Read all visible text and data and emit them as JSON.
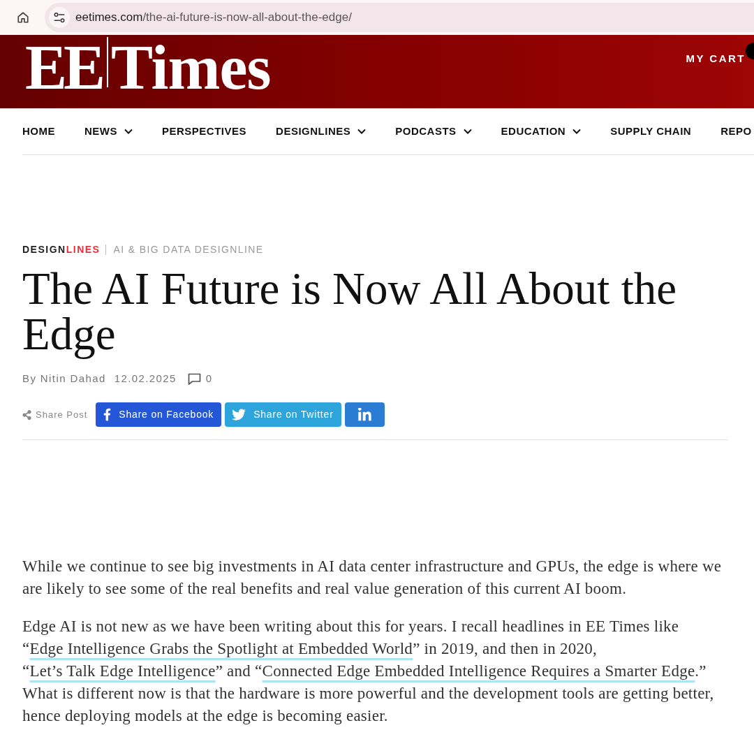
{
  "browser": {
    "url_host": "eetimes.com",
    "url_path": "/the-ai-future-is-now-all-about-the-edge/"
  },
  "header": {
    "logo": {
      "left": "EE",
      "right": "Times"
    },
    "cart": "MY CART"
  },
  "nav": {
    "items": [
      {
        "label": "HOME",
        "has_menu": false
      },
      {
        "label": "NEWS",
        "has_menu": true
      },
      {
        "label": "PERSPECTIVES",
        "has_menu": false
      },
      {
        "label": "DESIGNLINES",
        "has_menu": true
      },
      {
        "label": "PODCASTS",
        "has_menu": true
      },
      {
        "label": "EDUCATION",
        "has_menu": true
      },
      {
        "label": "SUPPLY CHAIN",
        "has_menu": false
      },
      {
        "label": "REPO",
        "has_menu": false
      }
    ]
  },
  "article": {
    "section": {
      "dark": "DESIGN",
      "accent": "LINES"
    },
    "category": "AI & BIG DATA DESIGNLINE",
    "title": "The AI Future is Now All About the Edge",
    "byline": "By Nitin Dahad",
    "date": "12.02.2025",
    "comment_count": "0",
    "share_label": "Share Post",
    "share_buttons": [
      {
        "kind": "facebook",
        "label": "Share on Facebook"
      },
      {
        "kind": "twitter",
        "label": "Share on Twitter"
      },
      {
        "kind": "linkedin"
      }
    ],
    "paragraphs": [
      [
        {
          "kind": "text",
          "text": "While we continue to see big investments in AI data center infrastructure and GPUs, the edge is where we are likely to see some of the real benefits and real value generation of this current AI boom."
        }
      ],
      [
        {
          "kind": "text",
          "text": "Edge AI is not new as we have been writing about this for years. I recall headlines in EE Times like “"
        },
        {
          "kind": "link",
          "text": "Edge Intelligence Grabs the Spotlight at Embedded World"
        },
        {
          "kind": "text",
          "text": "” in 2019, and then in 2020, “"
        },
        {
          "kind": "link",
          "text": "Let’s Talk Edge Intelligence"
        },
        {
          "kind": "text",
          "text": "” and “"
        },
        {
          "kind": "link",
          "text": "Connected Edge Embedded Intelligence Requires a Smarter Edge"
        },
        {
          "kind": "text",
          "text": ".” What is different now is that the hardware is more powerful and the development tools are getting better, hence deploying models at the edge is becoming easier."
        }
      ]
    ]
  }
}
